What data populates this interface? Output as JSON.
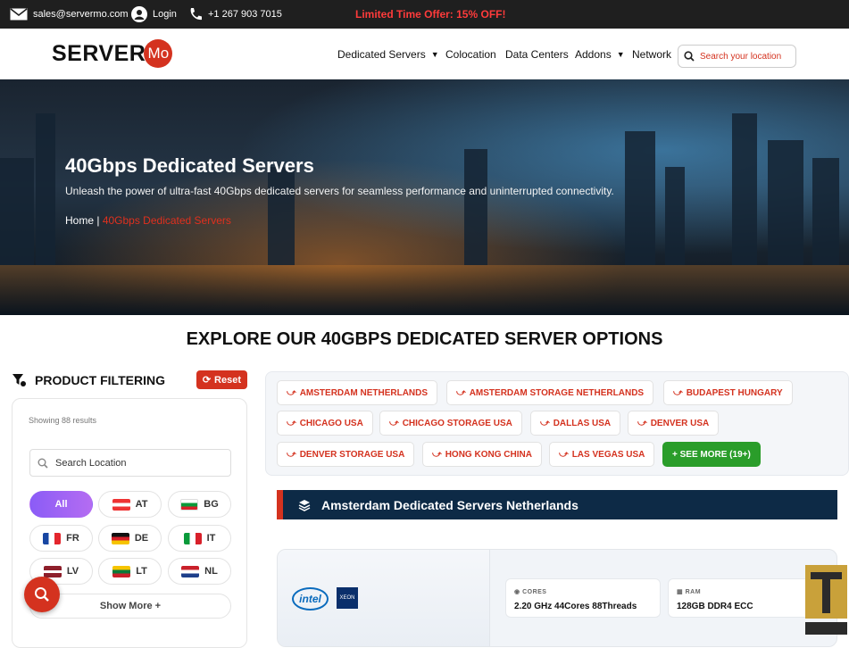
{
  "topbar": {
    "email": "sales@servermo.com",
    "login": "Login",
    "phone": "+1 267 903 7015",
    "offer": "Limited Time Offer: 15% OFF!"
  },
  "header": {
    "logo_word": "SERVER",
    "logo_badge": "Mo",
    "nav": [
      "Dedicated Servers",
      "Colocation",
      "Data Centers",
      "Addons",
      "Network"
    ],
    "search_placeholder": "Search your location"
  },
  "hero": {
    "title": "40Gbps Dedicated Servers",
    "subtitle": "Unleash the power of ultra-fast 40Gbps dedicated servers for seamless performance and uninterrupted connectivity.",
    "breadcrumb_home": "Home |",
    "breadcrumb_current": "40Gbps Dedicated Servers"
  },
  "section_title": "EXPLORE OUR 40GBPS DEDICATED SERVER OPTIONS",
  "filter": {
    "title": "PRODUCT FILTERING",
    "reset": "Reset",
    "showing": "Showing 88 results",
    "search_placeholder": "Search Location",
    "chips": [
      "All",
      "AT",
      "BG",
      "FR",
      "DE",
      "IT",
      "LV",
      "LT",
      "NL"
    ],
    "show_more": "Show More +"
  },
  "locations": [
    "AMSTERDAM NETHERLANDS",
    "AMSTERDAM STORAGE NETHERLANDS",
    "BUDAPEST HUNGARY",
    "CHICAGO USA",
    "CHICAGO STORAGE USA",
    "DALLAS USA",
    "DENVER USA",
    "DENVER STORAGE USA",
    "HONG KONG CHINA",
    "LAS VEGAS USA"
  ],
  "see_more": "+ SEE MORE (19+)",
  "location_banner": "Amsterdam Dedicated Servers Netherlands",
  "server_card": {
    "brand": "intel",
    "brand_badge": "XEON",
    "specs": [
      {
        "label": "CORES",
        "value": "2.20 GHz 44Cores 88Threads"
      },
      {
        "label": "RAM",
        "value": "128GB DDR4 ECC"
      }
    ]
  },
  "colors": {
    "accent": "#d4321f",
    "topbar": "#1f1f1f",
    "banner": "#0d2a46",
    "green": "#2a9d2a",
    "purple": "#8b5cf6"
  },
  "icons": [
    "envelope-icon",
    "user-icon",
    "phone-icon",
    "caret-down-icon",
    "search-icon",
    "filter-icon",
    "refresh-icon",
    "arrow-down-icon",
    "stack-icon",
    "chip-icon",
    "memory-icon"
  ]
}
